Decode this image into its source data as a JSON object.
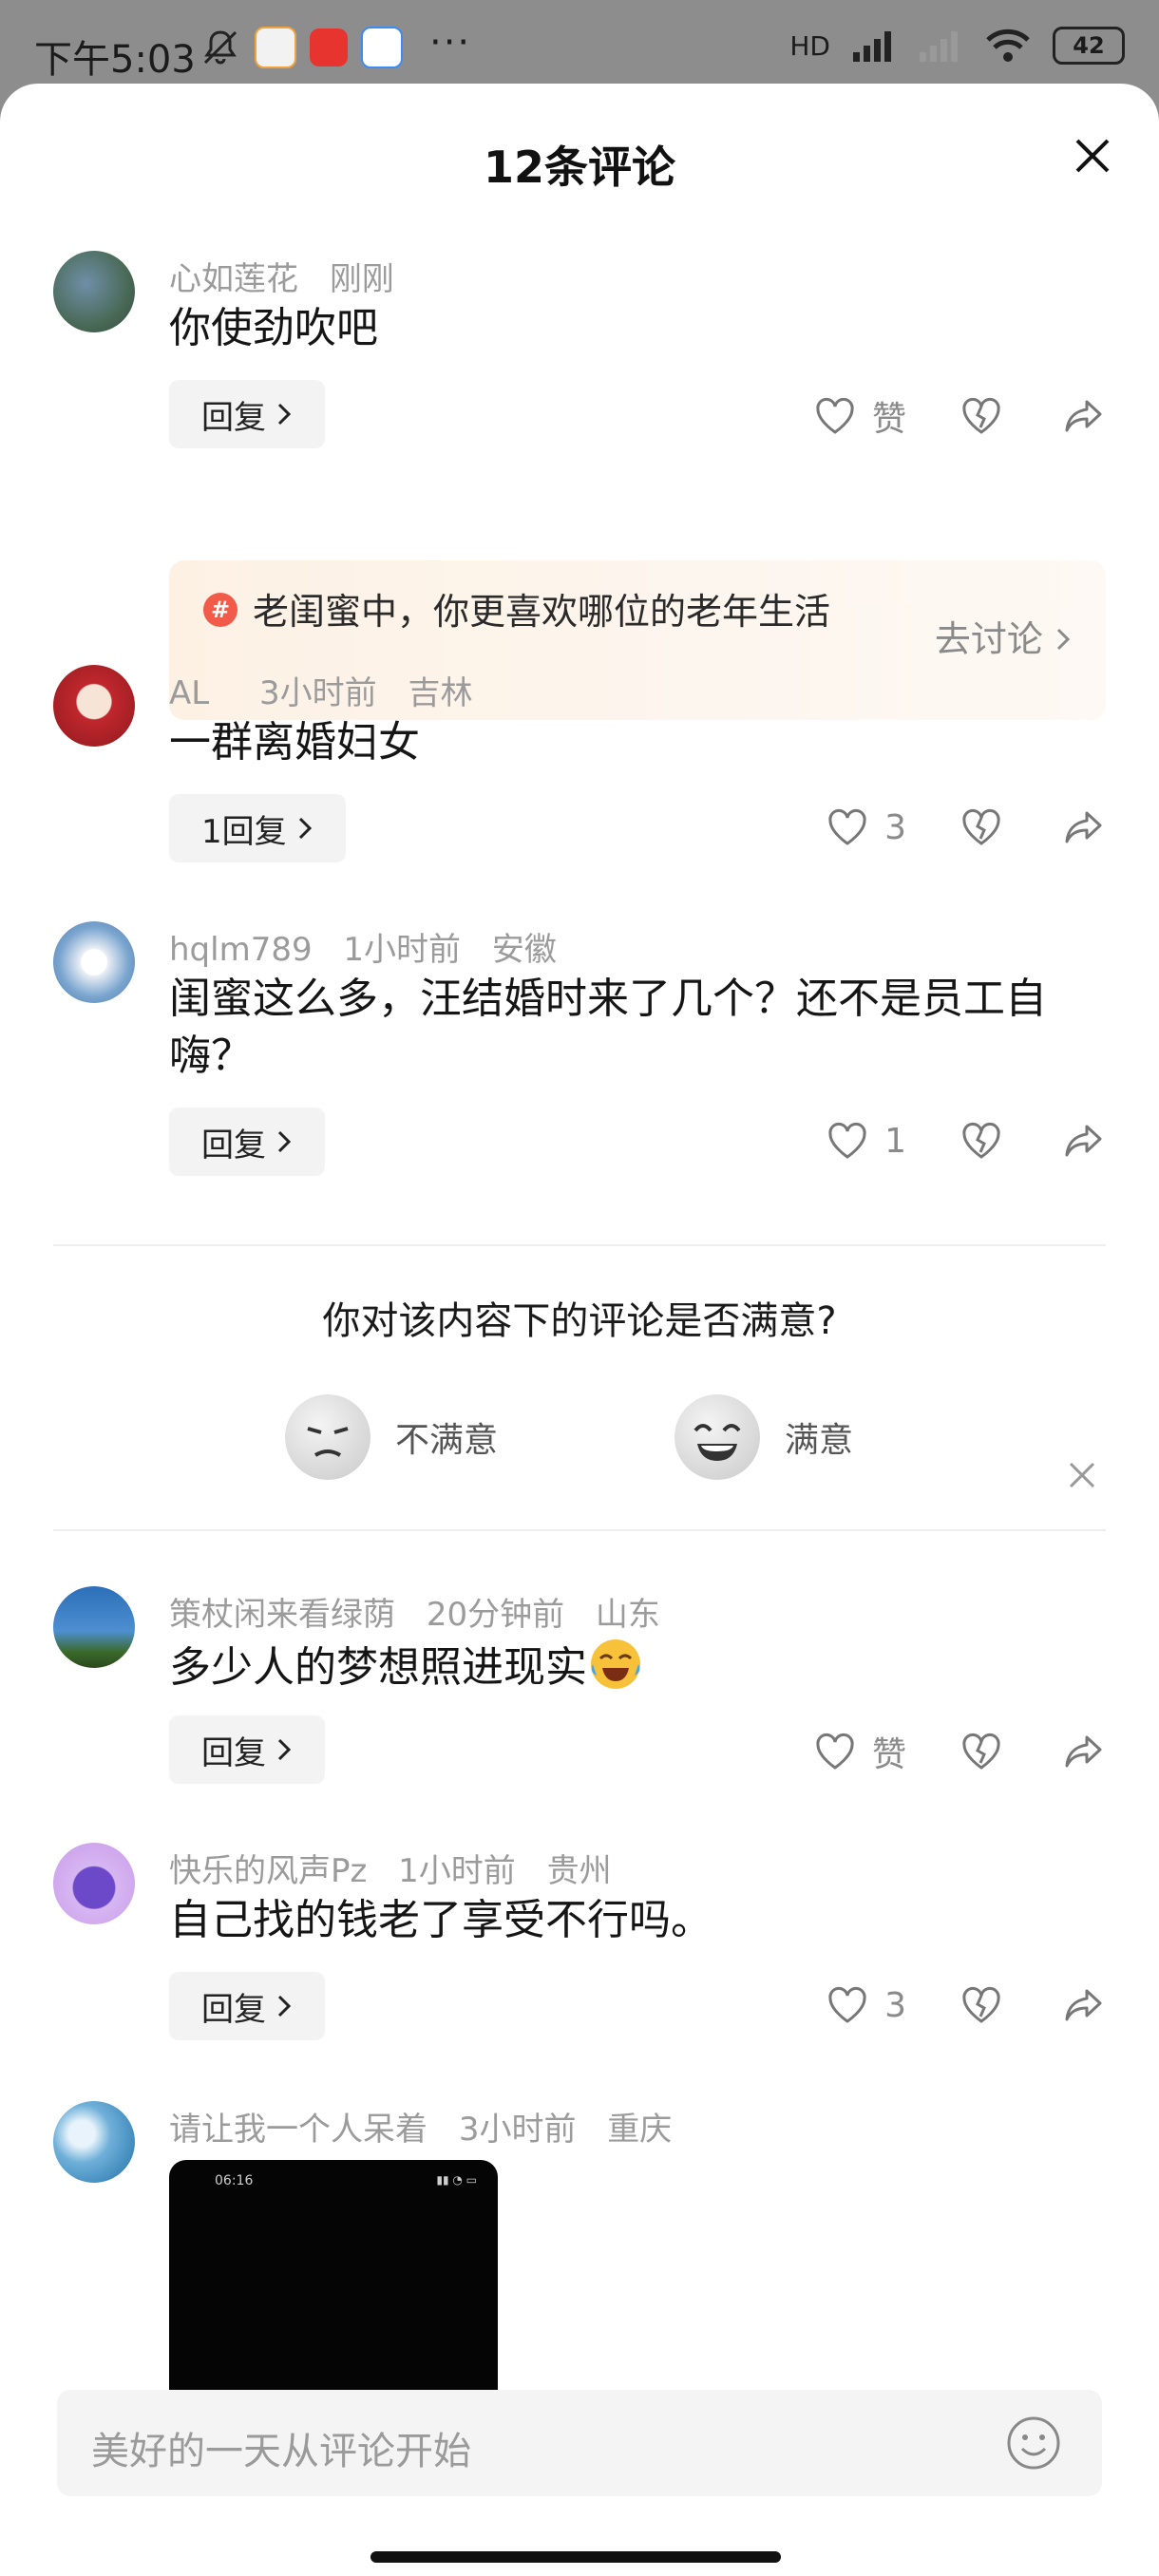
{
  "status_bar": {
    "time": "下午5:03",
    "more": "···",
    "signal_label": "HD",
    "battery": "42"
  },
  "sheet": {
    "title": "12条评论"
  },
  "topic_card": {
    "badge": "#",
    "text": "老闺蜜中，你更喜欢哪位的老年生活",
    "action": "去讨论"
  },
  "comments": [
    {
      "user": "心如莲花",
      "time": "刚刚",
      "location": "",
      "text": "你使劲吹吧",
      "reply": "回复",
      "likes": "赞"
    },
    {
      "user": "AL",
      "time": "3小时前",
      "location": "吉林",
      "text": "一群离婚妇女",
      "reply": "1回复",
      "likes": "3"
    },
    {
      "user": "hqlm789",
      "time": "1小时前",
      "location": "安徽",
      "text": "闺蜜这么多，汪结婚时来了几个？还不是员工自嗨？",
      "reply": "回复",
      "likes": "1"
    },
    {
      "user": "策杖闲来看绿荫",
      "time": "20分钟前",
      "location": "山东",
      "text": "多少人的梦想照进现实",
      "reply": "回复",
      "likes": "赞"
    },
    {
      "user": "快乐的风声Pz",
      "time": "1小时前",
      "location": "贵州",
      "text": "自己找的钱老了享受不行吗。",
      "reply": "回复",
      "likes": "3"
    },
    {
      "user": "请让我一个人呆着",
      "time": "3小时前",
      "location": "重庆",
      "text": "",
      "reply": "",
      "likes": ""
    }
  ],
  "survey": {
    "question": "你对该内容下的评论是否满意?",
    "negative": "不满意",
    "positive": "满意"
  },
  "thumb": {
    "time": "06:16"
  },
  "input": {
    "placeholder": "美好的一天从评论开始"
  },
  "colors": {
    "sheet_bg": "#ffffff",
    "meta_text": "#9b9b9b",
    "topic_badge": "#f25a4a",
    "overlay": "#8d8d8d"
  }
}
